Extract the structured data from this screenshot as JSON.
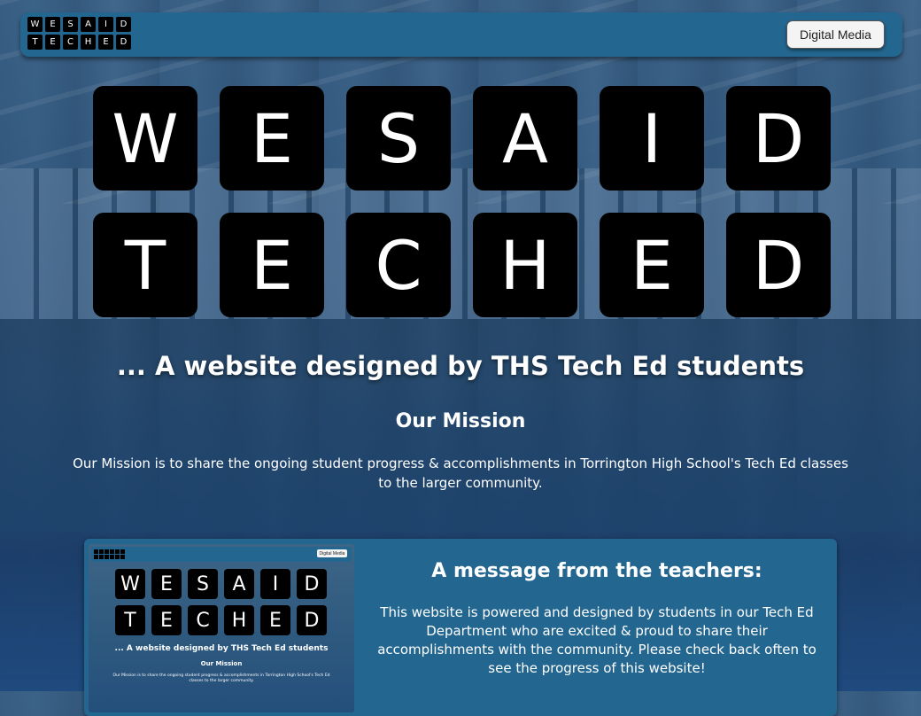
{
  "navbar": {
    "logo_rows": [
      [
        "W",
        "E",
        "S",
        "A",
        "I",
        "D"
      ],
      [
        "T",
        "E",
        "C",
        "H",
        "E",
        "D"
      ]
    ],
    "digital_media_button": "Digital Media"
  },
  "hero": {
    "logo_rows": [
      [
        "W",
        "E",
        "S",
        "A",
        "I",
        "D"
      ],
      [
        "T",
        "E",
        "C",
        "H",
        "E",
        "D"
      ]
    ],
    "tagline": "... A website designed by THS Tech Ed students"
  },
  "mission": {
    "title": "Our Mission",
    "text": "Our Mission is to share the ongoing student progress & accomplishments in Torrington High School's Tech Ed classes to the larger community."
  },
  "teacher_card": {
    "preview": {
      "button": "Digital Media",
      "logo_rows": [
        [
          "W",
          "E",
          "S",
          "A",
          "I",
          "D"
        ],
        [
          "T",
          "E",
          "C",
          "H",
          "E",
          "D"
        ]
      ],
      "tagline": "... A website designed by THS Tech Ed students",
      "mission_title": "Our Mission",
      "mission_text": "Our Mission is to share the ongoing student progress & accomplishments in Torrington High School's Tech Ed classes to the larger community."
    },
    "title": "A message from the teachers:",
    "text": "This website is powered and designed by students in our Tech Ed Department who are excited & proud to share their accomplishments with the community. Please check back often to see the progress of this website!"
  },
  "colors": {
    "navbar": "#236690",
    "tile": "#000000",
    "button_bg": "#f4f4f4"
  }
}
